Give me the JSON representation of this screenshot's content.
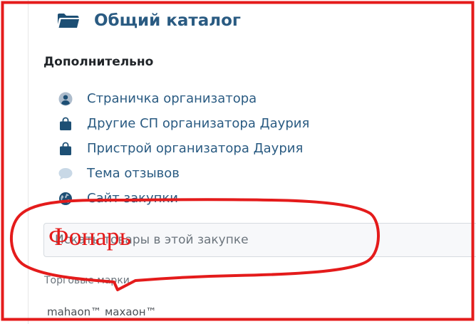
{
  "catalog": {
    "title": "Общий каталог",
    "icon": "folder-icon",
    "color": "#2a5b82"
  },
  "additional": {
    "heading": "Дополнительно",
    "items": [
      {
        "label": "Страничка организатора",
        "icon": "user-circle-icon"
      },
      {
        "label": "Другие СП организатора Даурия",
        "icon": "shopping-bag-icon"
      },
      {
        "label": "Пристрой организатора Даурия",
        "icon": "shopping-bag-icon"
      },
      {
        "label": "Тема отзывов",
        "icon": "comment-icon"
      },
      {
        "label": "Сайт закупки",
        "icon": "globe-icon"
      }
    ]
  },
  "search": {
    "placeholder": "Искать товары в этой закупке"
  },
  "brands": {
    "label": "Торговые марки",
    "items": [
      "mahaon™ махаон™"
    ]
  },
  "annotation": {
    "text": "Фонарь",
    "color": "#e41b1b"
  },
  "colors": {
    "link": "#2a5b82",
    "icon": "#1d4f74",
    "muted_icon": "#c8d8e6",
    "annotation": "#e41b1b"
  }
}
